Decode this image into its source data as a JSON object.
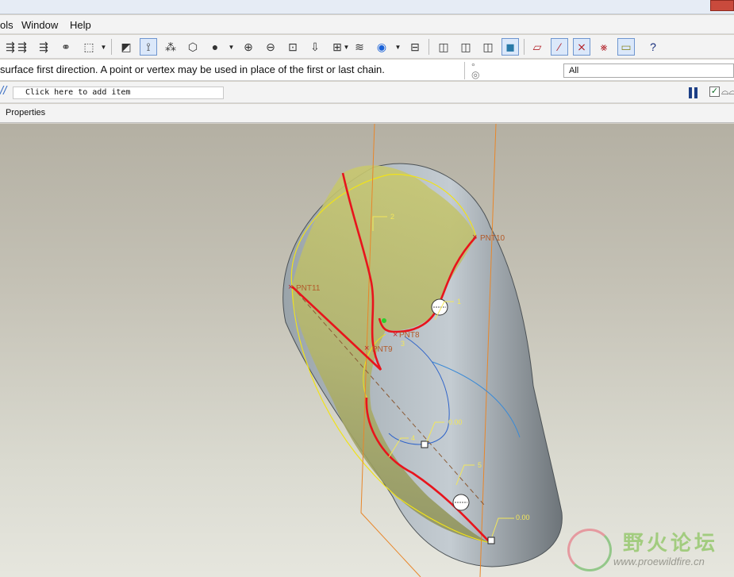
{
  "menu": {
    "tools_partial": "ols",
    "window": "Window",
    "help": "Help"
  },
  "toolbar": {
    "icons": [
      "regen-icon",
      "regen-manager-icon",
      "binoculars-icon",
      "select-box-icon",
      "datum-display-icon",
      "axis-display-icon",
      "point-display-icon",
      "csys-display-icon",
      "shade-sphere-icon",
      "zoom-in-icon",
      "zoom-out-icon",
      "refit-icon",
      "reorient-icon",
      "named-view-icon",
      "layers-icon",
      "appearance-sphere-icon",
      "model-tree-icon",
      "wireframe-icon",
      "hidden-line-icon",
      "no-hidden-icon",
      "shading-icon",
      "plane-display-icon",
      "axis-toggle-icon",
      "point-toggle-icon",
      "csys-toggle-icon",
      "annotation-toggle-icon",
      "whats-this-icon"
    ]
  },
  "message": {
    "text": "surface first direction. A point or vertex may be used in place of the first or last chain.",
    "filter_value": "All"
  },
  "dashboard": {
    "collector_placeholder": "Click here to add item",
    "pause_checked": true
  },
  "tabs": {
    "properties": "Properties"
  },
  "model": {
    "points": [
      {
        "label": "PNT10"
      },
      {
        "label": "PNT11"
      },
      {
        "label": "PNT8"
      },
      {
        "label": "PNT9"
      }
    ],
    "curve_tags": [
      "1",
      "2",
      "3",
      "4",
      "5"
    ],
    "dimensions": [
      "0.00",
      "0.00"
    ]
  },
  "colors": {
    "boundary_curve": "#e8141c",
    "surface": "#b9bb6a",
    "solid_body": "#aeb8be",
    "datum": "#e8862a",
    "guide_curve": "#2e63c9"
  },
  "watermark": {
    "title": "野火论坛",
    "url": "www.proewildfire.cn"
  }
}
